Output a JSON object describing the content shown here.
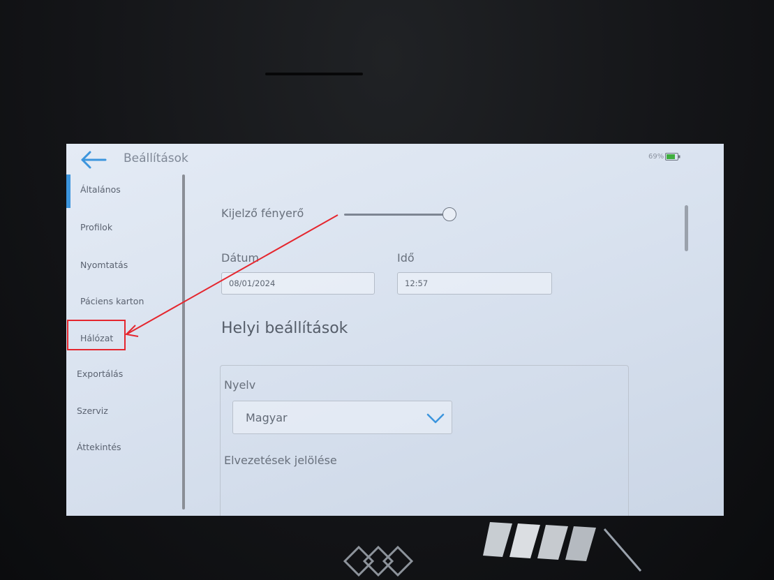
{
  "header": {
    "title": "Beállítások",
    "battery_percent": "69%"
  },
  "sidebar": {
    "items": [
      {
        "label": "Általános",
        "active": true
      },
      {
        "label": "Profilok"
      },
      {
        "label": "Nyomtatás"
      },
      {
        "label": "Páciens karton"
      },
      {
        "label": "Hálózat",
        "highlighted": true
      },
      {
        "label": "Exportálás"
      },
      {
        "label": "Szerviz"
      },
      {
        "label": "Áttekintés"
      }
    ]
  },
  "main": {
    "brightness_label": "Kijelző fényerő",
    "brightness_level": 1.0,
    "date_label": "Dátum",
    "date_value": "08/01/2024",
    "time_label": "Idő",
    "time_value": "12:57",
    "local_settings_title": "Helyi beállítások",
    "language_label": "Nyelv",
    "language_value": "Magyar",
    "leads_label": "Elvezetések jelölése"
  },
  "colors": {
    "accent": "#3c95dd",
    "annotation": "#e5262e",
    "battery": "#3fae3f"
  },
  "icons": {
    "back": "back-arrow-icon",
    "dropdown": "chevron-down-icon",
    "battery": "battery-icon"
  }
}
